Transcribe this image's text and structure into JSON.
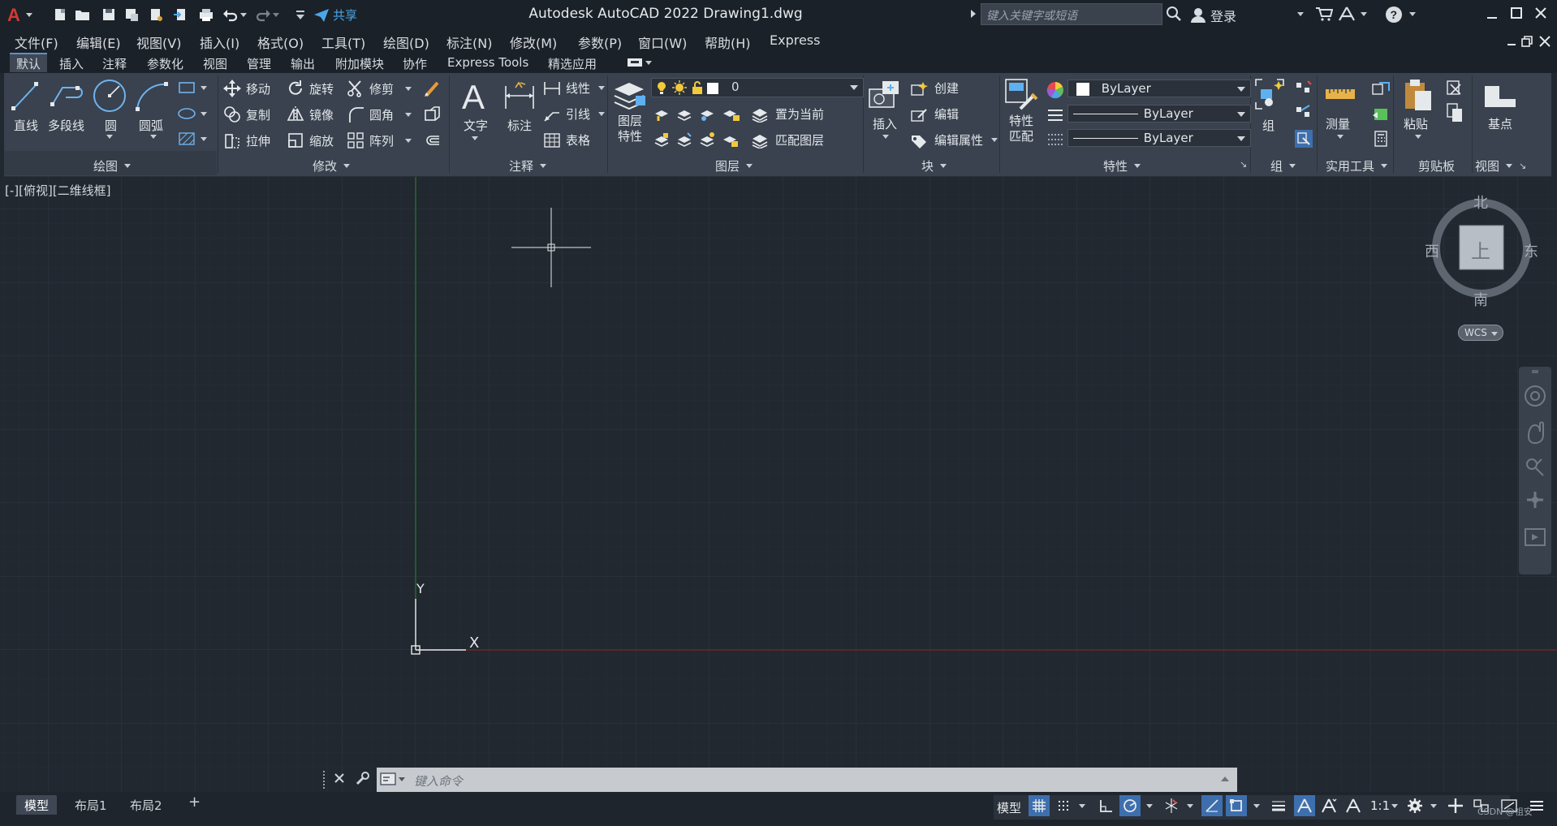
{
  "titlebar": {
    "app_title": "Autodesk AutoCAD 2022    Drawing1.dwg",
    "share_label": "共享",
    "search_placeholder": "键入关键字或短语",
    "signin_label": "登录"
  },
  "menubar": {
    "items": [
      "文件(F)",
      "编辑(E)",
      "视图(V)",
      "插入(I)",
      "格式(O)",
      "工具(T)",
      "绘图(D)",
      "标注(N)",
      "修改(M)",
      "参数(P)",
      "窗口(W)",
      "帮助(H)",
      "Express"
    ]
  },
  "ribbon_tabs": {
    "items": [
      "默认",
      "插入",
      "注释",
      "参数化",
      "视图",
      "管理",
      "输出",
      "附加模块",
      "协作",
      "Express Tools",
      "精选应用"
    ],
    "active": "默认"
  },
  "ribbon": {
    "draw": {
      "line": "直线",
      "polyline": "多段线",
      "circle": "圆",
      "arc": "圆弧",
      "panel": "绘图"
    },
    "modify": {
      "move": "移动",
      "rotate": "旋转",
      "trim": "修剪",
      "copy": "复制",
      "mirror": "镜像",
      "fillet": "圆角",
      "stretch": "拉伸",
      "scale": "缩放",
      "array": "阵列",
      "panel": "修改"
    },
    "annotation": {
      "text": "文字",
      "dimension": "标注",
      "linear": "线性",
      "leader": "引线",
      "table": "表格",
      "panel": "注释"
    },
    "layers": {
      "layer_props_1": "图层",
      "layer_props_2": "特性",
      "current_layer": "0",
      "make_current": "置为当前",
      "match_layer": "匹配图层",
      "panel": "图层"
    },
    "block": {
      "insert": "插入",
      "create": "创建",
      "edit": "编辑",
      "edit_attr": "编辑属性",
      "panel": "块"
    },
    "properties": {
      "match_1": "特性",
      "match_2": "匹配",
      "color": "ByLayer",
      "linetype": "ByLayer",
      "lineweight": "ByLayer",
      "panel": "特性"
    },
    "groups": {
      "group": "组",
      "panel": "组"
    },
    "utilities": {
      "measure": "测量",
      "panel": "实用工具"
    },
    "clipboard": {
      "paste": "粘贴",
      "panel": "剪贴板"
    },
    "view": {
      "base": "基点",
      "panel": "视图"
    }
  },
  "viewport": {
    "label": "[-][俯视][二维线框]",
    "ucs_x": "X",
    "ucs_y": "Y"
  },
  "viewcube": {
    "north": "北",
    "south": "南",
    "east": "东",
    "west": "西",
    "top": "上",
    "wcs": "WCS"
  },
  "commandline": {
    "placeholder": "键入命令"
  },
  "statusbar": {
    "layout_tabs": [
      "模型",
      "布局1",
      "布局2"
    ],
    "active_tab": "模型",
    "add_tab": "+",
    "model_label": "模型",
    "scale": "1:1",
    "watermark": "CSDN @祖安"
  },
  "colors": {
    "background": "#212830",
    "ribbon": "#39424e",
    "accent_blue": "#3d6fae",
    "grid_minor": "#283039",
    "grid_major": "#2f3842",
    "y_axis": "#2c6b2c",
    "x_axis": "#6b2828"
  }
}
